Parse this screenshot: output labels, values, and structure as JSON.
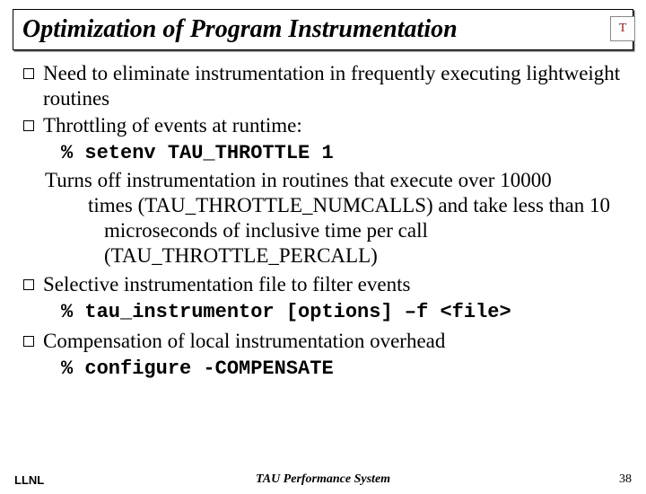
{
  "title": "Optimization of Program Instrumentation",
  "logo": "T",
  "bullets": {
    "b1": "Need to eliminate instrumentation in frequently executing lightweight routines",
    "b2": "Throttling of events at runtime:",
    "code1": "% setenv TAU_THROTTLE 1",
    "explain_line1": "Turns off instrumentation in routines that execute over 10000",
    "explain_rest": "times (TAU_THROTTLE_NUMCALLS) and take less than 10 microseconds of inclusive time per call (TAU_THROTTLE_PERCALL)",
    "b3": "Selective instrumentation file to filter events",
    "code2": "% tau_instrumentor [options] –f <file>",
    "b4": "Compensation of local instrumentation overhead",
    "code3": "% configure -COMPENSATE"
  },
  "footer": {
    "left": "LLNL",
    "center": "TAU Performance System",
    "right": "38"
  }
}
